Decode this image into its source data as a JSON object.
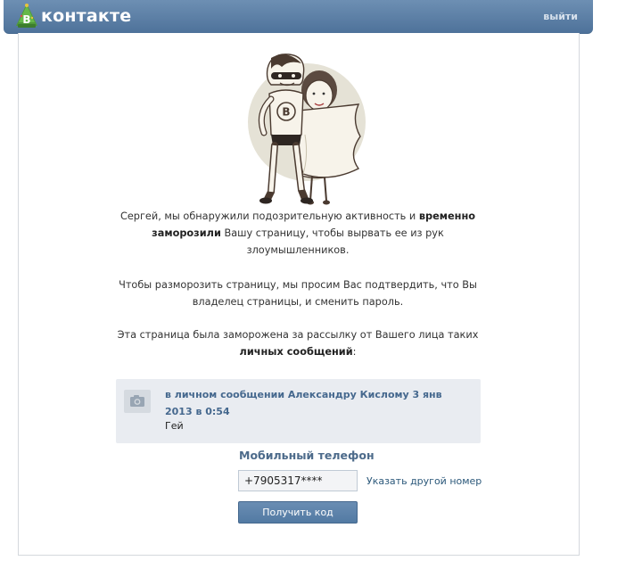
{
  "header": {
    "logo_letter": "В",
    "logo_text": "контакте",
    "logout_label": "выйти"
  },
  "notice": {
    "p1_part1": "Сергей, мы обнаружили подозрительную активность и ",
    "p1_bold": "временно заморозили",
    "p1_part2": " Вашу страницу, чтобы вырвать ее из рук злоумышленников.",
    "p2": "Чтобы разморозить страницу, мы просим Вас подтвердить, что Вы владелец страницы, и сменить пароль.",
    "p3_part1": "Эта страница была заморожена за рассылку от Вашего лица таких ",
    "p3_bold": "личных сообщений",
    "p3_part2": ":"
  },
  "message": {
    "icon": "camera-icon",
    "title": "в личном сообщении Александру Кислому 3 янв 2013 в 0:54",
    "body": "Гей"
  },
  "phone": {
    "label": "Мобильный телефон",
    "value": "+7905317****",
    "other_number_link": "Указать другой номер",
    "submit_label": "Получить код"
  },
  "colors": {
    "header": "#597da3",
    "link": "#2b587a",
    "message_bg": "#e9ecf1"
  }
}
